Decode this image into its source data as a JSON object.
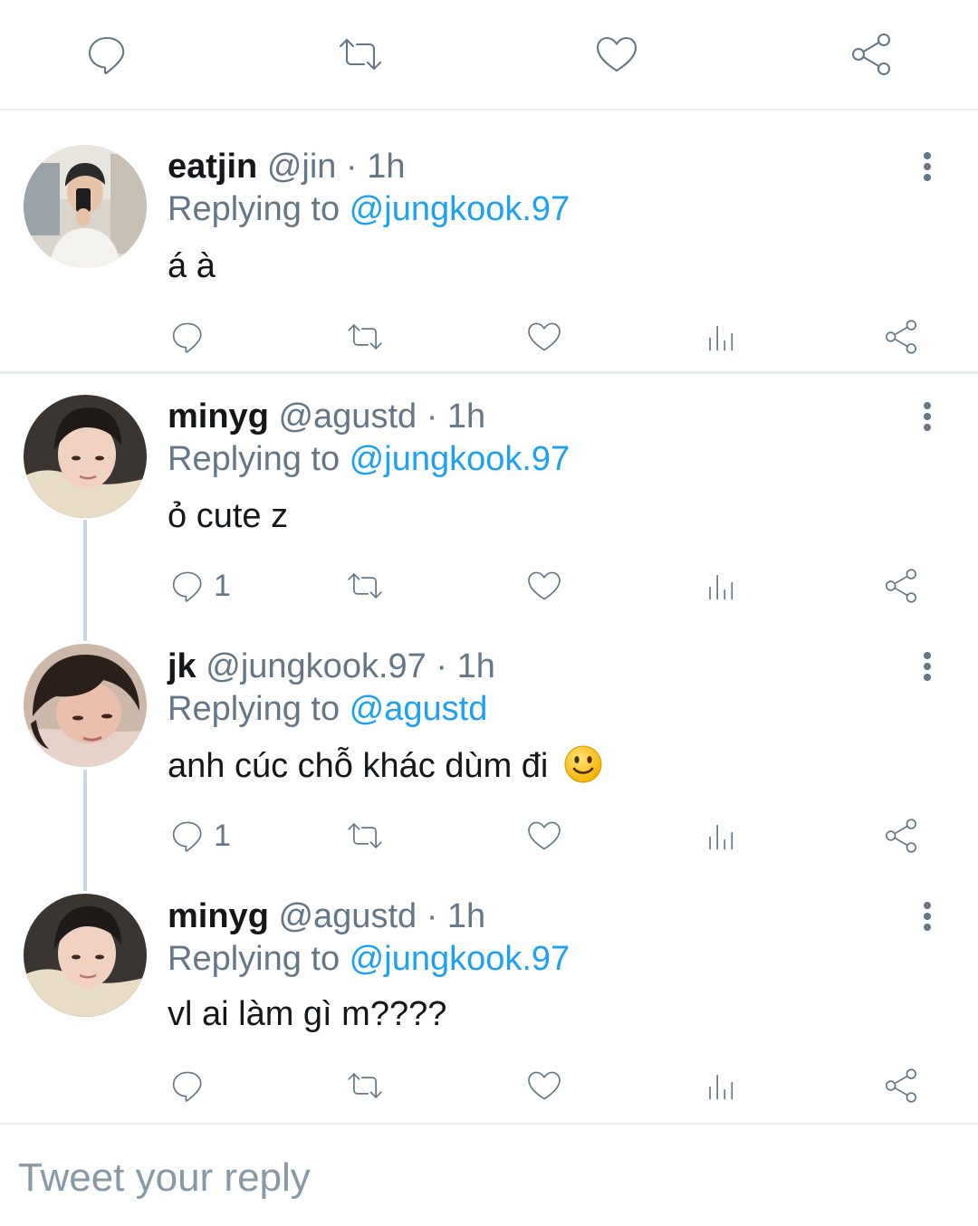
{
  "top_actions": {
    "icons": [
      "reply-icon",
      "retweet-icon",
      "like-icon",
      "share-icon"
    ]
  },
  "tweets": [
    {
      "name": "eatjin",
      "handle": "@jin",
      "separator": "·",
      "time": "1h",
      "replying_prefix": "Replying to ",
      "replying_to": "@jungkook.97",
      "text": "á à",
      "reply_count": "",
      "avatar": "avatar-eatjin"
    },
    {
      "name": "minyg",
      "handle": "@agustd",
      "separator": "·",
      "time": "1h",
      "replying_prefix": "Replying to ",
      "replying_to": "@jungkook.97",
      "text": "ỏ cute z",
      "reply_count": "1",
      "avatar": "avatar-minyg"
    },
    {
      "name": "jk",
      "handle": "@jungkook.97",
      "separator": "·",
      "time": "1h",
      "replying_prefix": "Replying to ",
      "replying_to": "@agustd",
      "text": "anh cúc chỗ khác dùm đi",
      "emoji": "slightly-smiling-face",
      "reply_count": "1",
      "avatar": "avatar-jk"
    },
    {
      "name": "minyg",
      "handle": "@agustd",
      "separator": "·",
      "time": "1h",
      "replying_prefix": "Replying to ",
      "replying_to": "@jungkook.97",
      "text": "vl ai làm gì m????",
      "reply_count": "",
      "avatar": "avatar-minyg"
    }
  ],
  "reply_box": {
    "placeholder": "Tweet your reply"
  },
  "colors": {
    "text": "#14171a",
    "secondary": "#657786",
    "mention": "#1da1f2",
    "divider": "#e6ecf0",
    "thread_line": "#ccd6dd"
  }
}
